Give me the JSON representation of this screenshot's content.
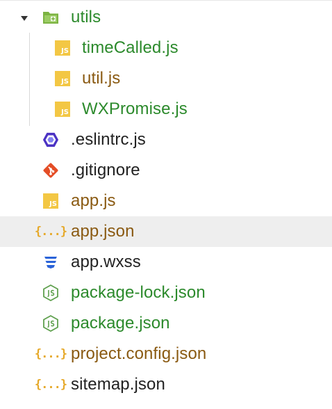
{
  "tree": {
    "folder": {
      "label": "utils",
      "expanded": true,
      "icon": "folder-open-icon"
    },
    "items": [
      {
        "label": "timeCalled.js",
        "icon": "js-icon",
        "color": "#2c8a2c",
        "nested": true
      },
      {
        "label": "util.js",
        "icon": "js-icon",
        "color": "#8a5a12",
        "nested": true
      },
      {
        "label": "WXPromise.js",
        "icon": "js-icon",
        "color": "#2c8a2c",
        "nested": true
      },
      {
        "label": ".eslintrc.js",
        "icon": "eslint-icon",
        "color": "#222222",
        "nested": false
      },
      {
        "label": ".gitignore",
        "icon": "git-icon",
        "color": "#222222",
        "nested": false
      },
      {
        "label": "app.js",
        "icon": "js-icon",
        "color": "#8a5a12",
        "nested": false
      },
      {
        "label": "app.json",
        "icon": "json-braces-icon",
        "color": "#8a5a12",
        "nested": false,
        "selected": true
      },
      {
        "label": "app.wxss",
        "icon": "css-icon",
        "color": "#222222",
        "nested": false
      },
      {
        "label": "package-lock.json",
        "icon": "nodejs-icon",
        "color": "#2c8a2c",
        "nested": false
      },
      {
        "label": "package.json",
        "icon": "nodejs-icon",
        "color": "#2c8a2c",
        "nested": false
      },
      {
        "label": "project.config.json",
        "icon": "json-braces-icon",
        "color": "#8a5a12",
        "nested": false
      },
      {
        "label": "sitemap.json",
        "icon": "json-braces-icon",
        "color": "#222222",
        "nested": false
      }
    ],
    "js_badge_text": "JS",
    "braces_text": "{...}"
  },
  "colors": {
    "green": "#2c8a2c",
    "brown": "#8a5a12",
    "dark": "#222222",
    "selected_row": "#eeeeee",
    "js_yellow": "#f3c744",
    "json_orange": "#e6a92a",
    "eslint_blue": "#4b32c3",
    "git_red": "#e44d26",
    "css_blue": "#2a63d8",
    "node_green": "#5fa04e"
  }
}
